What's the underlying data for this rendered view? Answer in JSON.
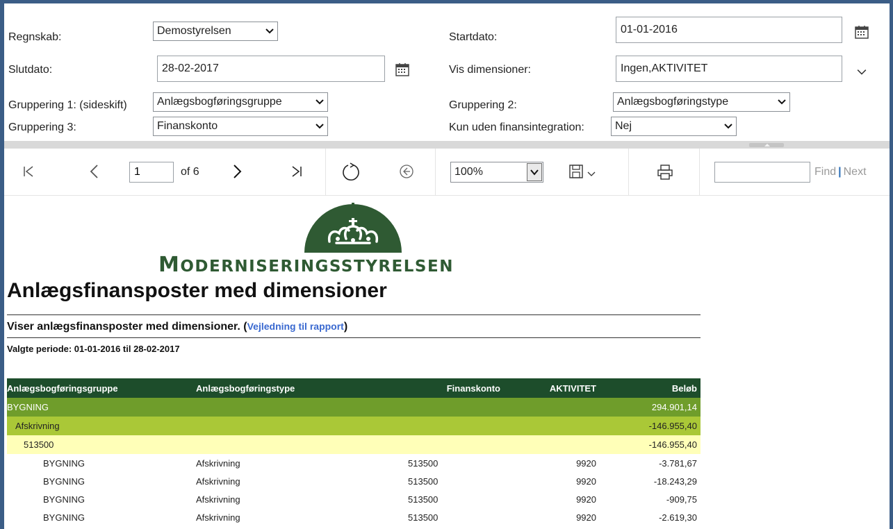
{
  "params": {
    "regnskab": {
      "label": "Regnskab:",
      "value": "Demostyrelsen"
    },
    "startdato": {
      "label": "Startdato:",
      "value": "01-01-2016"
    },
    "slutdato": {
      "label": "Slutdato:",
      "value": "28-02-2017"
    },
    "vis_dimensioner": {
      "label": "Vis dimensioner:",
      "value": "Ingen,AKTIVITET"
    },
    "gruppering1": {
      "label": "Gruppering 1: (sideskift)",
      "value": "Anlægsbogføringsgruppe"
    },
    "gruppering2": {
      "label": "Gruppering 2:",
      "value": "Anlægsbogføringstype"
    },
    "gruppering3": {
      "label": "Gruppering 3:",
      "value": "Finanskonto"
    },
    "kun_uden": {
      "label": "Kun uden finansintegration:",
      "value": "Nej"
    }
  },
  "toolbar": {
    "page_value": "1",
    "page_of": "of 6",
    "zoom_value": "100%",
    "find_label": "Find",
    "find_sep": "|",
    "next_label": "Next"
  },
  "report": {
    "agency_first": "M",
    "agency_rest": "ODERNISERINGSSTYRELSEN",
    "title": "Anlægsfinansposter med dimensioner",
    "description": "Viser anlægsfinansposter med dimensioner. (",
    "guide_link": "Vejledning til rapport",
    "description_end": ")",
    "period": "Valgte periode: 01-01-2016 til 28-02-2017",
    "colors": {
      "header": "#1d4d2b",
      "group1": "#6f9d2b",
      "group2": "#aac837",
      "group3": "#ffffb8",
      "logo": "#2f5a33"
    }
  },
  "table": {
    "headers": [
      "Anlægsbogføringsgruppe",
      "Anlægsbogføringstype",
      "Finanskonto",
      "AKTIVITET",
      "Beløb"
    ],
    "groups": [
      {
        "label": "BYGNING",
        "amount": "294.901,14"
      },
      {
        "label": "Afskrivning",
        "amount": "-146.955,40"
      },
      {
        "label": "513500",
        "amount": "-146.955,40"
      }
    ],
    "rows": [
      {
        "gruppe": "BYGNING",
        "type": "Afskrivning",
        "konto": "513500",
        "aktivitet": "9920",
        "belob": "-3.781,67"
      },
      {
        "gruppe": "BYGNING",
        "type": "Afskrivning",
        "konto": "513500",
        "aktivitet": "9920",
        "belob": "-18.243,29"
      },
      {
        "gruppe": "BYGNING",
        "type": "Afskrivning",
        "konto": "513500",
        "aktivitet": "9920",
        "belob": "-909,75"
      },
      {
        "gruppe": "BYGNING",
        "type": "Afskrivning",
        "konto": "513500",
        "aktivitet": "9920",
        "belob": "-2.619,30"
      }
    ]
  }
}
